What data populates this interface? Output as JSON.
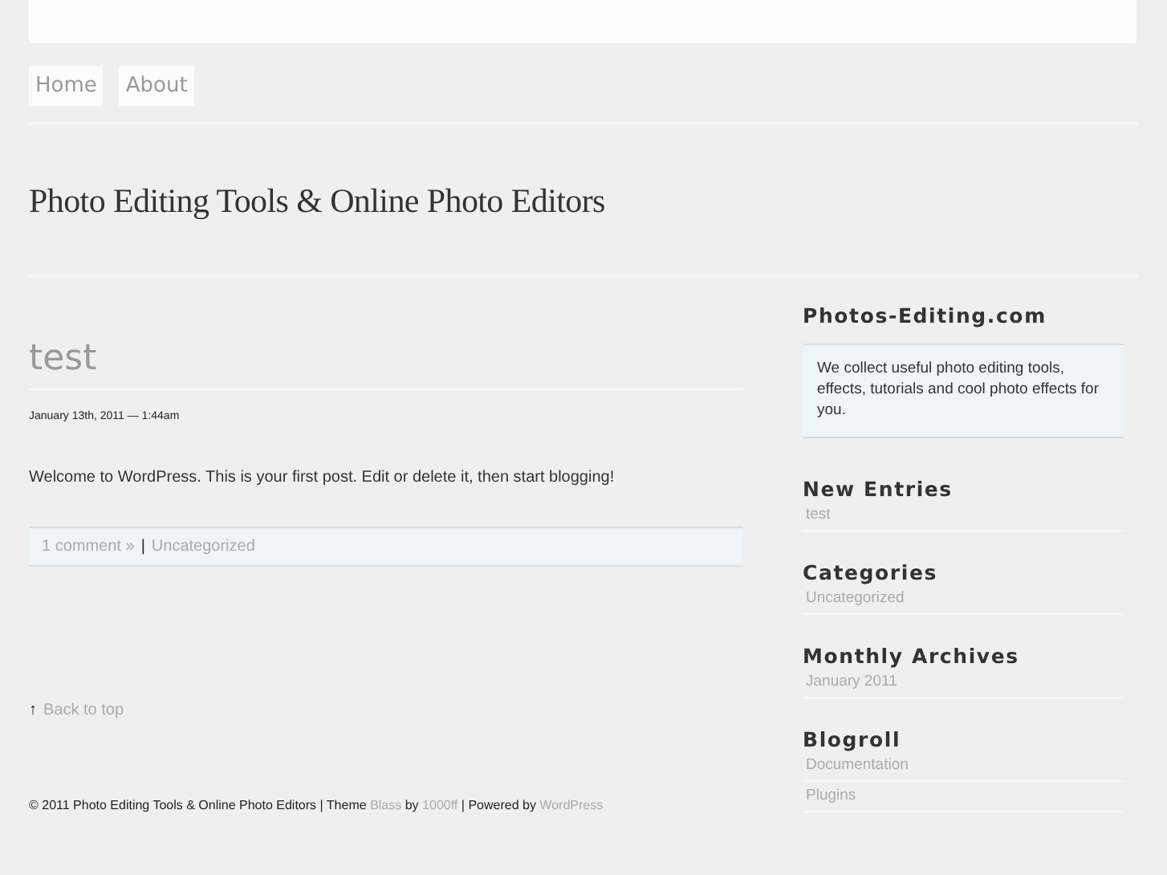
{
  "nav": [
    {
      "label": "Home"
    },
    {
      "label": "About"
    }
  ],
  "site_title": "Photo Editing Tools & Online Photo Editors",
  "post": {
    "title": "test",
    "date": "January 13th, 2011 — 1:44am",
    "body": "Welcome to WordPress. This is your first post. Edit or delete it, then start blogging!",
    "meta": [
      {
        "kind": "link",
        "text": "1 comment »"
      },
      {
        "kind": "text",
        "text": "|"
      },
      {
        "kind": "link",
        "text": "Uncategorized"
      }
    ]
  },
  "back_to_top": {
    "arrow": "↑",
    "label": "Back to top"
  },
  "footer": [
    {
      "kind": "text",
      "text": "© 2011 Photo Editing Tools & Online Photo Editors | Theme"
    },
    {
      "kind": "link",
      "text": "Blass"
    },
    {
      "kind": "text",
      "text": "by"
    },
    {
      "kind": "link",
      "text": "1000ff"
    },
    {
      "kind": "text",
      "text": "| Powered by"
    },
    {
      "kind": "link",
      "text": "WordPress"
    }
  ],
  "sidebar": {
    "about": {
      "title": "Photos-Editing.com",
      "text": "We collect useful photo editing tools, effects, tutorials and cool photo effects for you."
    },
    "widgets": [
      {
        "title": "New Entries",
        "items": [
          "test"
        ]
      },
      {
        "title": "Categories",
        "items": [
          "Uncategorized"
        ]
      },
      {
        "title": "Monthly Archives",
        "items": [
          "January 2011"
        ]
      },
      {
        "title": "Blogroll",
        "items": [
          "Documentation",
          "Plugins"
        ]
      }
    ]
  }
}
